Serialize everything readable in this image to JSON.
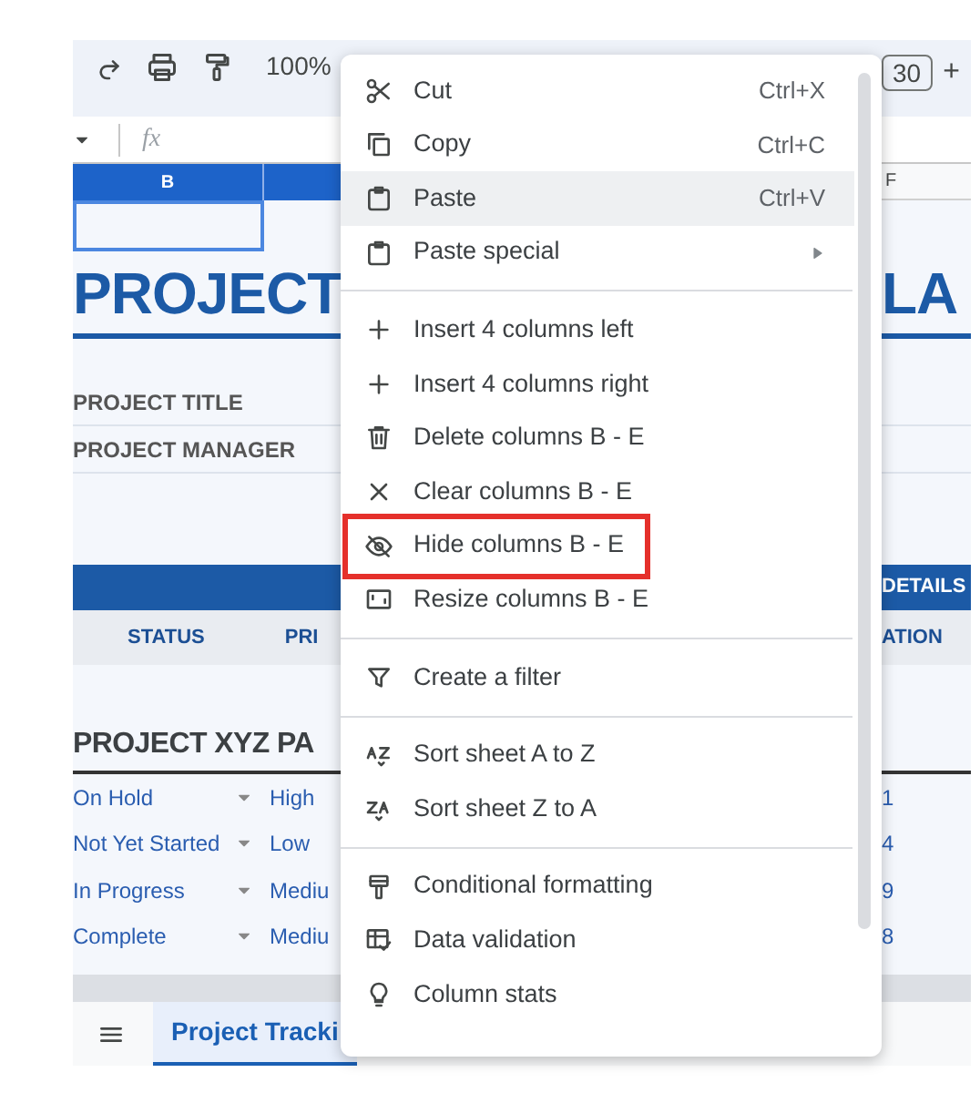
{
  "toolbar": {
    "zoom": "100%",
    "font_size": "30",
    "increase": "+"
  },
  "formula_bar": {
    "fx": "fx"
  },
  "column_headers": {
    "left": "B",
    "right": "F"
  },
  "title": {
    "left": "PROJECT",
    "right": "LA"
  },
  "fields": [
    "PROJECT TITLE",
    "PROJECT MANAGER"
  ],
  "band": {
    "right": "DETAILS"
  },
  "table_headers": {
    "left": [
      "STATUS",
      "PRI"
    ],
    "right": "ATION"
  },
  "section_title": "PROJECT XYZ PA",
  "rows": [
    {
      "status": "On Hold",
      "priority": "High",
      "column_3": "1"
    },
    {
      "status": "Not Yet Started",
      "priority": "Low",
      "column_3": "4"
    },
    {
      "status": "In Progress",
      "priority": "Mediu",
      "column_3": "9"
    },
    {
      "status": "Complete",
      "priority": "Mediu",
      "column_3": "8"
    }
  ],
  "sheet_tabs": [
    {
      "label": "Project Tracki",
      "selected": true
    }
  ],
  "context_menu": {
    "items": [
      {
        "kind": "item",
        "label": "Cut",
        "shortcut": "Ctrl+X",
        "selected": false,
        "highlighted": false,
        "submenu": false
      },
      {
        "kind": "item",
        "label": "Copy",
        "shortcut": "Ctrl+C",
        "selected": false,
        "highlighted": false,
        "submenu": false
      },
      {
        "kind": "item",
        "label": "Paste",
        "shortcut": "Ctrl+V",
        "selected": true,
        "highlighted": false,
        "submenu": false
      },
      {
        "kind": "item",
        "label": "Paste special",
        "selected": false,
        "highlighted": false,
        "submenu": true
      },
      {
        "kind": "separator"
      },
      {
        "kind": "item",
        "label": "Insert 4 columns left",
        "selected": false,
        "highlighted": false,
        "submenu": false
      },
      {
        "kind": "item",
        "label": "Insert 4 columns right",
        "selected": false,
        "highlighted": false,
        "submenu": false
      },
      {
        "kind": "item",
        "label": "Delete columns B - E",
        "selected": false,
        "highlighted": false,
        "submenu": false
      },
      {
        "kind": "item",
        "label": "Clear columns B - E",
        "selected": false,
        "highlighted": false,
        "submenu": false
      },
      {
        "kind": "item",
        "label": "Hide columns B - E",
        "selected": false,
        "highlighted": true,
        "submenu": false
      },
      {
        "kind": "item",
        "label": "Resize columns B - E",
        "selected": false,
        "highlighted": false,
        "submenu": false
      },
      {
        "kind": "separator"
      },
      {
        "kind": "item",
        "label": "Create a filter",
        "selected": false,
        "highlighted": false,
        "submenu": false
      },
      {
        "kind": "separator"
      },
      {
        "kind": "item",
        "label": "Sort sheet A to Z",
        "selected": false,
        "highlighted": false,
        "submenu": false
      },
      {
        "kind": "item",
        "label": "Sort sheet Z to A",
        "selected": false,
        "highlighted": false,
        "submenu": false
      },
      {
        "kind": "separator"
      },
      {
        "kind": "item",
        "label": "Conditional formatting",
        "selected": false,
        "highlighted": false,
        "submenu": false
      },
      {
        "kind": "item",
        "label": "Data validation",
        "selected": false,
        "highlighted": false,
        "submenu": false
      },
      {
        "kind": "item",
        "label": "Column stats",
        "selected": false,
        "highlighted": false,
        "submenu": false
      }
    ]
  }
}
